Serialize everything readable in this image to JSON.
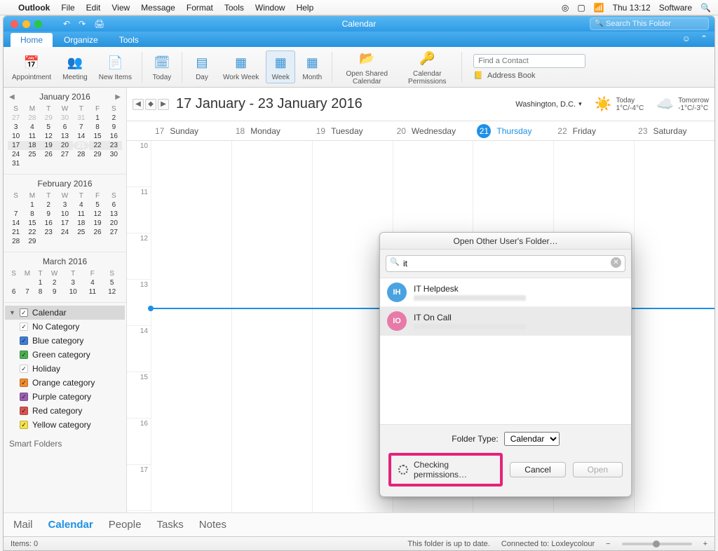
{
  "mac_menu": {
    "app": "Outlook",
    "items": [
      "File",
      "Edit",
      "View",
      "Message",
      "Format",
      "Tools",
      "Window",
      "Help"
    ],
    "clock": "Thu 13:12",
    "user": "Software"
  },
  "titlebar": {
    "title": "Calendar",
    "search_placeholder": "Search This Folder"
  },
  "ribbon_tabs": {
    "home": "Home",
    "organize": "Organize",
    "tools": "Tools"
  },
  "ribbon": {
    "appointment": "Appointment",
    "meeting": "Meeting",
    "new_items": "New Items",
    "today": "Today",
    "day": "Day",
    "work_week": "Work Week",
    "week": "Week",
    "month": "Month",
    "open_shared": "Open Shared Calendar",
    "cal_perm": "Calendar Permissions",
    "find_contact_placeholder": "Find a Contact",
    "address_book": "Address Book"
  },
  "minicals": [
    {
      "title": "January 2016"
    },
    {
      "title": "February 2016"
    },
    {
      "title": "March 2016"
    }
  ],
  "dow": [
    "S",
    "M",
    "T",
    "W",
    "T",
    "F",
    "S"
  ],
  "categories": {
    "calendar": "Calendar",
    "items": [
      {
        "label": "No Category",
        "color": "#ffffff"
      },
      {
        "label": "Blue category",
        "color": "#3f7fd6"
      },
      {
        "label": "Green category",
        "color": "#4caf50"
      },
      {
        "label": "Holiday",
        "color": "#ffffff"
      },
      {
        "label": "Orange category",
        "color": "#f08b2c"
      },
      {
        "label": "Purple category",
        "color": "#9a5fb0"
      },
      {
        "label": "Red category",
        "color": "#d9534f"
      },
      {
        "label": "Yellow category",
        "color": "#f2e24b"
      }
    ],
    "smart": "Smart Folders"
  },
  "cal_header": {
    "range": "17 January - 23 January 2016",
    "location": "Washington,  D.C.",
    "today_lbl": "Today",
    "today_temp": "1°C/-4°C",
    "tomorrow_lbl": "Tomorrow",
    "tomorrow_temp": "-1°C/-3°C"
  },
  "days": [
    {
      "num": "17",
      "name": "Sunday"
    },
    {
      "num": "18",
      "name": "Monday"
    },
    {
      "num": "19",
      "name": "Tuesday"
    },
    {
      "num": "20",
      "name": "Wednesday"
    },
    {
      "num": "21",
      "name": "Thursday",
      "today": true
    },
    {
      "num": "22",
      "name": "Friday"
    },
    {
      "num": "23",
      "name": "Saturday"
    }
  ],
  "hours": [
    "10",
    "11",
    "12",
    "13",
    "14",
    "15",
    "16",
    "17"
  ],
  "bottom_tabs": {
    "mail": "Mail",
    "calendar": "Calendar",
    "people": "People",
    "tasks": "Tasks",
    "notes": "Notes"
  },
  "status": {
    "items": "Items: 0",
    "uptodate": "This folder is up to date.",
    "connected": "Connected to: Loxleycolour"
  },
  "dialog": {
    "title": "Open Other User's Folder…",
    "search_value": "it",
    "results": [
      {
        "initials": "IH",
        "color": "#4aa3e0",
        "name": "IT Helpdesk"
      },
      {
        "initials": "IO",
        "color": "#e77aa8",
        "name": "IT On Call"
      }
    ],
    "folder_type_label": "Folder Type:",
    "folder_type_value": "Calendar",
    "checking": "Checking permissions…",
    "cancel": "Cancel",
    "open": "Open"
  }
}
